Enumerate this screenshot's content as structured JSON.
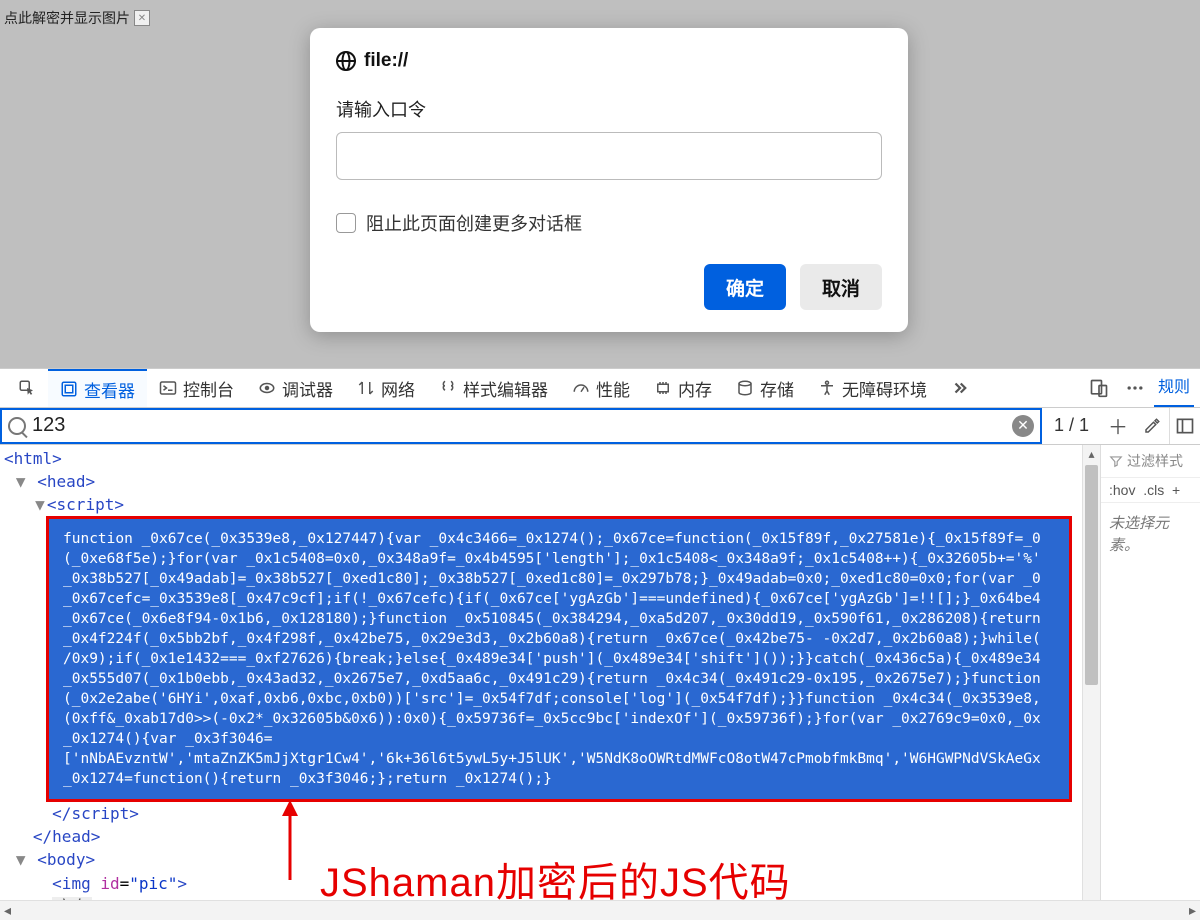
{
  "page": {
    "decrypt_text": "点此解密并显示图片"
  },
  "dialog": {
    "origin": "file://",
    "label": "请输入口令",
    "checkbox_label": "阻止此页面创建更多对话框",
    "ok": "确定",
    "cancel": "取消"
  },
  "devtools": {
    "tabs": {
      "inspector": "查看器",
      "console": "控制台",
      "debugger": "调试器",
      "network": "网络",
      "styleeditor": "样式编辑器",
      "perf": "性能",
      "memory": "内存",
      "storage": "存储",
      "a11y": "无障碍环境"
    },
    "rules_tab": "规则",
    "search": {
      "value": "123",
      "count": "1 / 1"
    },
    "dom": {
      "html_open": "<html>",
      "head_open": "<head>",
      "script_open": "<script>",
      "script_close": "</script>",
      "head_close": "</head>",
      "body_open": "<body>",
      "img_line": "<img id=\"pic\">",
      "blank": "空白"
    },
    "obf_code": "function _0x67ce(_0x3539e8,_0x127447){var _0x4c3466=_0x1274();_0x67ce=function(_0x15f89f,_0x27581e){_0x15f89f=_0\n(_0xe68f5e);}for(var _0x1c5408=0x0,_0x348a9f=_0x4b4595['length'];_0x1c5408<_0x348a9f;_0x1c5408++){_0x32605b+='%'\n_0x38b527[_0x49adab]=_0x38b527[_0xed1c80];_0x38b527[_0xed1c80]=_0x297b78;}_0x49adab=0x0;_0xed1c80=0x0;for(var _0\n_0x67cefc=_0x3539e8[_0x47c9cf];if(!_0x67cefc){if(_0x67ce['ygAzGb']===undefined){_0x67ce['ygAzGb']=!![];}_0x64be4\n_0x67ce(_0x6e8f94-0x1b6,_0x128180);}function _0x510845(_0x384294,_0xa5d207,_0x30dd19,_0x590f61,_0x286208){return\n_0x4f224f(_0x5bb2bf,_0x4f298f,_0x42be75,_0x29e3d3,_0x2b60a8){return _0x67ce(_0x42be75- -0x2d7,_0x2b60a8);}while(\n/0x9);if(_0x1e1432===_0xf27626){break;}else{_0x489e34['push'](_0x489e34['shift']());}}catch(_0x436c5a){_0x489e34\n_0x555d07(_0x1b0ebb,_0x43ad32,_0x2675e7,_0xd5aa6c,_0x491c29){return _0x4c34(_0x491c29-0x195,_0x2675e7);}function\n(_0x2e2abe('6HYi',0xaf,0xb6,0xbc,0xb0))['src']=_0x54f7df;console['log'](_0x54f7df);}}function _0x4c34(_0x3539e8,\n(0xff&_0xab17d0>>(-0x2*_0x32605b&0x6)):0x0){_0x59736f=_0x5cc9bc['indexOf'](_0x59736f);}for(var _0x2769c9=0x0,_0x\n_0x1274(){var _0x3f3046=\n['nNbAEvzntW','mtaZnZK5mJjXtgr1Cw4','6k+36l6t5ywL5y+J5lUK','W5NdK8oOWRtdMWFcO8otW47cPmobfmkBmq','W6HGWPNdVSkAeGx\n_0x1274=function(){return _0x3f3046;};return _0x1274();}",
    "right": {
      "filter": "过滤样式",
      "hov": ":hov",
      "cls": ".cls",
      "plus": "+",
      "no_element": "未选择元素。"
    }
  },
  "annotation": {
    "text": "JShaman加密后的JS代码"
  }
}
